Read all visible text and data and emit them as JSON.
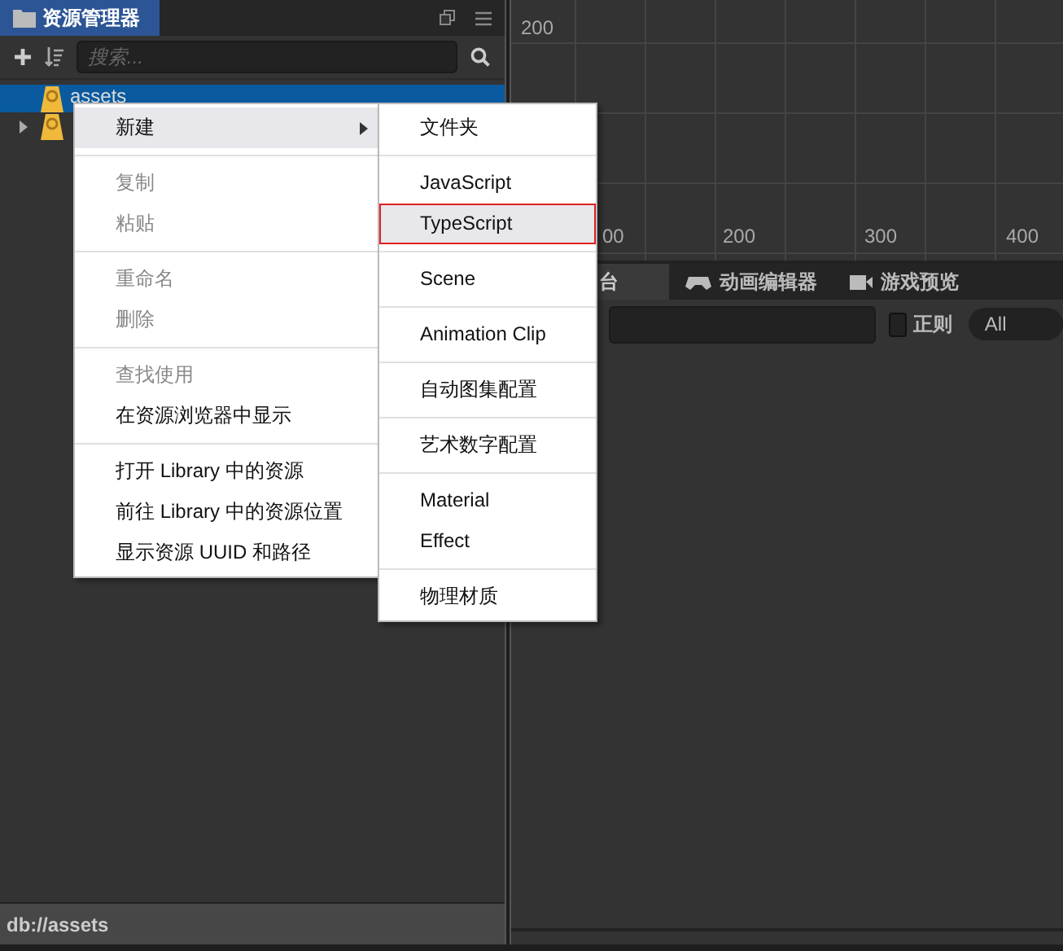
{
  "assets_panel": {
    "title": "资源管理器",
    "search": {
      "placeholder": "搜索..."
    },
    "tree": [
      {
        "label": "assets",
        "selected": true,
        "expandable": false
      },
      {
        "selected": false,
        "expandable": true
      }
    ],
    "status_bar": "db://assets"
  },
  "scene": {
    "y_labels": [
      "200"
    ],
    "x_labels": [
      "00",
      "200",
      "300",
      "400"
    ]
  },
  "bottom_tabs": [
    {
      "label": "台",
      "selected": true
    },
    {
      "label": "动画编辑器",
      "selected": false
    },
    {
      "label": "游戏预览",
      "selected": false
    }
  ],
  "console_filter": {
    "regex": {
      "label": "正则",
      "checked": false
    },
    "level": "All"
  },
  "context_menu": {
    "groups": [
      [
        {
          "label": "新建",
          "disabled": false,
          "selected": true,
          "submenu": true
        }
      ],
      [
        {
          "label": "复制",
          "disabled": true,
          "selected": false,
          "submenu": false
        },
        {
          "label": "粘贴",
          "disabled": true,
          "selected": false,
          "submenu": false
        }
      ],
      [
        {
          "label": "重命名",
          "disabled": true,
          "selected": false,
          "submenu": false
        },
        {
          "label": "删除",
          "disabled": true,
          "selected": false,
          "submenu": false
        }
      ],
      [
        {
          "label": "查找使用",
          "disabled": true,
          "selected": false,
          "submenu": false
        },
        {
          "label": "在资源浏览器中显示",
          "disabled": false,
          "selected": false,
          "submenu": false
        }
      ],
      [
        {
          "label": "打开 Library 中的资源",
          "disabled": false,
          "selected": false,
          "submenu": false
        },
        {
          "label": "前往 Library 中的资源位置",
          "disabled": false,
          "selected": false,
          "submenu": false
        },
        {
          "label": "显示资源 UUID 和路径",
          "disabled": false,
          "selected": false,
          "submenu": false
        }
      ]
    ]
  },
  "submenu": {
    "groups": [
      [
        {
          "label": "文件夹",
          "selected": false
        }
      ],
      [
        {
          "label": "JavaScript",
          "selected": false
        },
        {
          "label": "TypeScript",
          "selected": true
        }
      ],
      [
        {
          "label": "Scene",
          "selected": false
        }
      ],
      [
        {
          "label": "Animation Clip",
          "selected": false
        }
      ],
      [
        {
          "label": "自动图集配置",
          "selected": false
        }
      ],
      [
        {
          "label": "艺术数字配置",
          "selected": false
        }
      ],
      [
        {
          "label": "Material",
          "selected": false
        },
        {
          "label": "Effect",
          "selected": false
        }
      ],
      [
        {
          "label": "物理材质",
          "selected": false
        }
      ]
    ]
  }
}
